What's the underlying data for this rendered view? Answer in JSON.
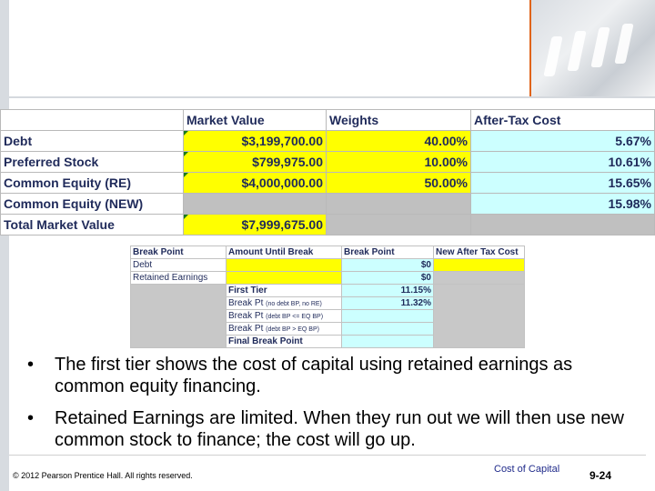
{
  "market_table": {
    "headers": [
      "",
      "Market Value",
      "Weights",
      "After-Tax Cost"
    ],
    "rows": [
      {
        "label": "Debt",
        "market_value": "$3,199,700.00",
        "weight": "40.00%",
        "cost": "5.67%"
      },
      {
        "label": "Preferred Stock",
        "market_value": "$799,975.00",
        "weight": "10.00%",
        "cost": "10.61%"
      },
      {
        "label": "Common Equity (RE)",
        "market_value": "$4,000,000.00",
        "weight": "50.00%",
        "cost": "15.65%"
      },
      {
        "label": "Common Equity (NEW)",
        "market_value": "",
        "weight": "",
        "cost": "15.98%"
      },
      {
        "label": "Total Market Value",
        "market_value": "$7,999,675.00",
        "weight": "",
        "cost": ""
      }
    ]
  },
  "break_table": {
    "headers": [
      "Break Point",
      "Amount Until Break",
      "Break Point",
      "New After Tax Cost"
    ],
    "rows": [
      {
        "label": "Debt",
        "value": "$0"
      },
      {
        "label": "Retained Earnings",
        "value": "$0"
      }
    ],
    "tiers": [
      {
        "label": "First Tier",
        "note": "",
        "value": "11.15%"
      },
      {
        "label": "Break Pt",
        "note": "(no debt BP, no RE)",
        "value": "11.32%"
      },
      {
        "label": "Break Pt",
        "note": "(debt BP <= EQ BP)",
        "value": ""
      },
      {
        "label": "Break Pt",
        "note": "(debt BP > EQ BP)",
        "value": ""
      },
      {
        "label": "Final Break Point",
        "note": "",
        "value": ""
      }
    ]
  },
  "bullets": [
    "The first tier shows the cost of capital using retained earnings as common equity financing.",
    "Retained Earnings are limited. When they run out we will then use new common stock to finance; the cost will go up."
  ],
  "bullet_glyph": "•",
  "footer": {
    "copyright": "© 2012 Pearson Prentice Hall. All rights reserved.",
    "section": "Cost of Capital",
    "page": "9-24"
  },
  "colors": {
    "accent": "#e0641a",
    "highlight_yellow": "#ffff00",
    "highlight_cyan": "#ccffff",
    "text_navy": "#1f2a5a"
  }
}
